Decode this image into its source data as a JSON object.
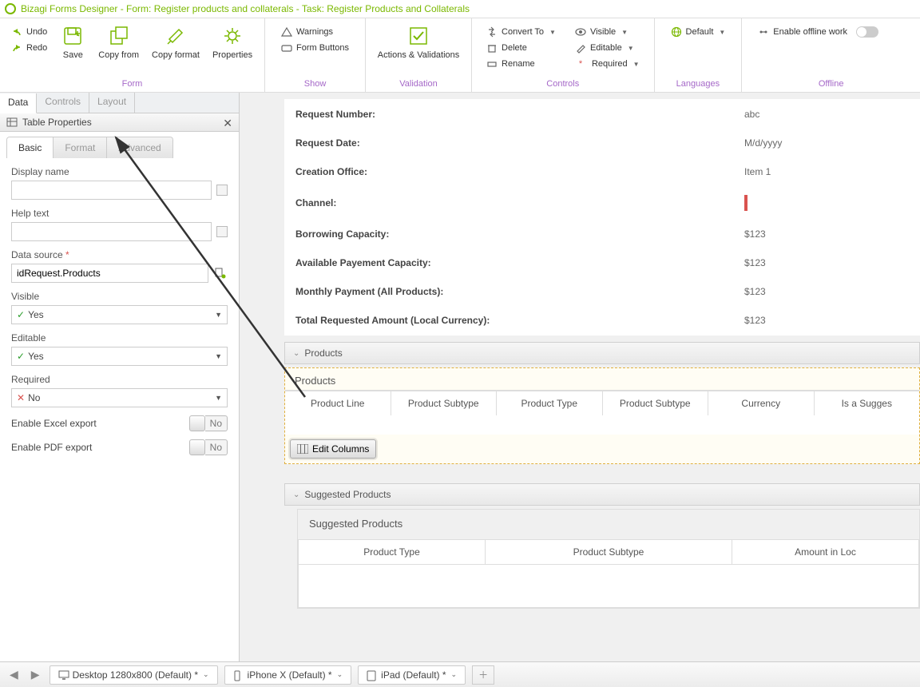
{
  "title": "Bizagi Forms Designer  - Form: Register products and collaterals - Task:  Register Products and Collaterals",
  "ribbon": {
    "undo": "Undo",
    "redo": "Redo",
    "save": "Save",
    "copy_from": "Copy from",
    "copy_format": "Copy format",
    "properties": "Properties",
    "warnings": "Warnings",
    "form_buttons": "Form Buttons",
    "actions_validations": "Actions & Validations",
    "convert_to": "Convert To",
    "delete": "Delete",
    "rename": "Rename",
    "visible": "Visible",
    "editable": "Editable",
    "required": "Required",
    "default": "Default",
    "enable_offline": "Enable offline work",
    "groups": {
      "form": "Form",
      "show": "Show",
      "validation": "Validation",
      "controls": "Controls",
      "languages": "Languages",
      "offline": "Offline"
    }
  },
  "side_tabs": {
    "data": "Data",
    "controls": "Controls",
    "layout": "Layout"
  },
  "panel": {
    "title": "Table Properties",
    "tabs": {
      "basic": "Basic",
      "format": "Format",
      "advanced": "Advanced"
    },
    "display_name_label": "Display name",
    "help_text_label": "Help text",
    "data_source_label": "Data source",
    "data_source_value": "idRequest.Products",
    "visible_label": "Visible",
    "visible_value": "Yes",
    "editable_label": "Editable",
    "editable_value": "Yes",
    "required_label": "Required",
    "required_value": "No",
    "excel_label": "Enable Excel export",
    "excel_value": "No",
    "pdf_label": "Enable PDF export",
    "pdf_value": "No"
  },
  "form_fields": [
    {
      "label": "Request Number:",
      "value": "abc"
    },
    {
      "label": "Request Date:",
      "value": "M/d/yyyy"
    },
    {
      "label": "Creation Office:",
      "value": "Item 1"
    },
    {
      "label": "Channel:",
      "value": ""
    },
    {
      "label": "Borrowing Capacity:",
      "value": "$123"
    },
    {
      "label": "Available Payement Capacity:",
      "value": "$123"
    },
    {
      "label": "Monthly Payment (All Products):",
      "value": "$123"
    },
    {
      "label": "Total Requested Amount (Local Currency):",
      "value": "$123"
    }
  ],
  "products_section": {
    "title": "Products",
    "grid_title": "Products",
    "columns": [
      "Product Line",
      "Product Subtype",
      "Product Type",
      "Product Subtype",
      "Currency",
      "Is a Sugges"
    ],
    "edit_columns": "Edit Columns"
  },
  "suggested_section": {
    "title": "Suggested Products",
    "grid_title": "Suggested Products",
    "columns": [
      "Product Type",
      "Product Subtype",
      "Amount in Loc"
    ]
  },
  "footer_tabs": [
    {
      "name": "Desktop 1280x800 (Default) *",
      "device": "desktop"
    },
    {
      "name": "iPhone X (Default) *",
      "device": "phone"
    },
    {
      "name": "iPad (Default) *",
      "device": "tablet"
    }
  ]
}
